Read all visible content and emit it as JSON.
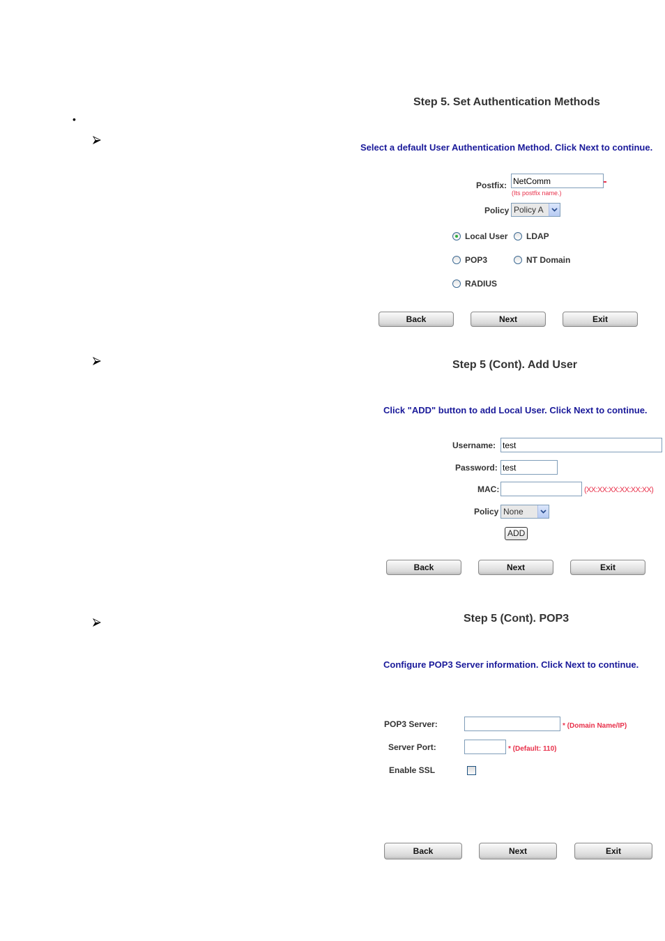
{
  "bullet": "•",
  "sections": {
    "auth": {
      "title": "Step 5. Set Authentication Methods",
      "instruction": "Select a default User Authentication Method. Click Next to continue.",
      "postfix_label": "Postfix:",
      "postfix_value": "NetComm",
      "postfix_hint": "(Its postfix name.)",
      "policy_label": "Policy",
      "policy_value": "Policy A",
      "methods": [
        {
          "label": "Local User",
          "checked": true
        },
        {
          "label": "LDAP",
          "checked": false
        },
        {
          "label": "POP3",
          "checked": false
        },
        {
          "label": "NT Domain",
          "checked": false
        },
        {
          "label": "RADIUS",
          "checked": false
        }
      ],
      "buttons": {
        "back": "Back",
        "next": "Next",
        "exit": "Exit"
      }
    },
    "add_user": {
      "title": "Step 5 (Cont). Add User",
      "instruction": "Click \"ADD\" button to add Local User. Click Next to continue.",
      "username_label": "Username:",
      "username_value": "test",
      "password_label": "Password:",
      "password_value": "test",
      "mac_label": "MAC:",
      "mac_value": "",
      "mac_hint": "(XX:XX:XX:XX:XX:XX)",
      "policy_label": "Policy",
      "policy_value": "None",
      "add_label": "ADD",
      "buttons": {
        "back": "Back",
        "next": "Next",
        "exit": "Exit"
      }
    },
    "pop3": {
      "title": "Step 5 (Cont). POP3",
      "instruction": "Configure POP3 Server information. Click Next to continue.",
      "server_label": "POP3 Server:",
      "server_value": "",
      "server_hint": "* (Domain Name/IP)",
      "port_label": "Server Port:",
      "port_value": "",
      "port_hint": "* (Default: 110)",
      "ssl_label": "Enable SSL",
      "ssl_checked": false,
      "buttons": {
        "back": "Back",
        "next": "Next",
        "exit": "Exit"
      }
    }
  }
}
